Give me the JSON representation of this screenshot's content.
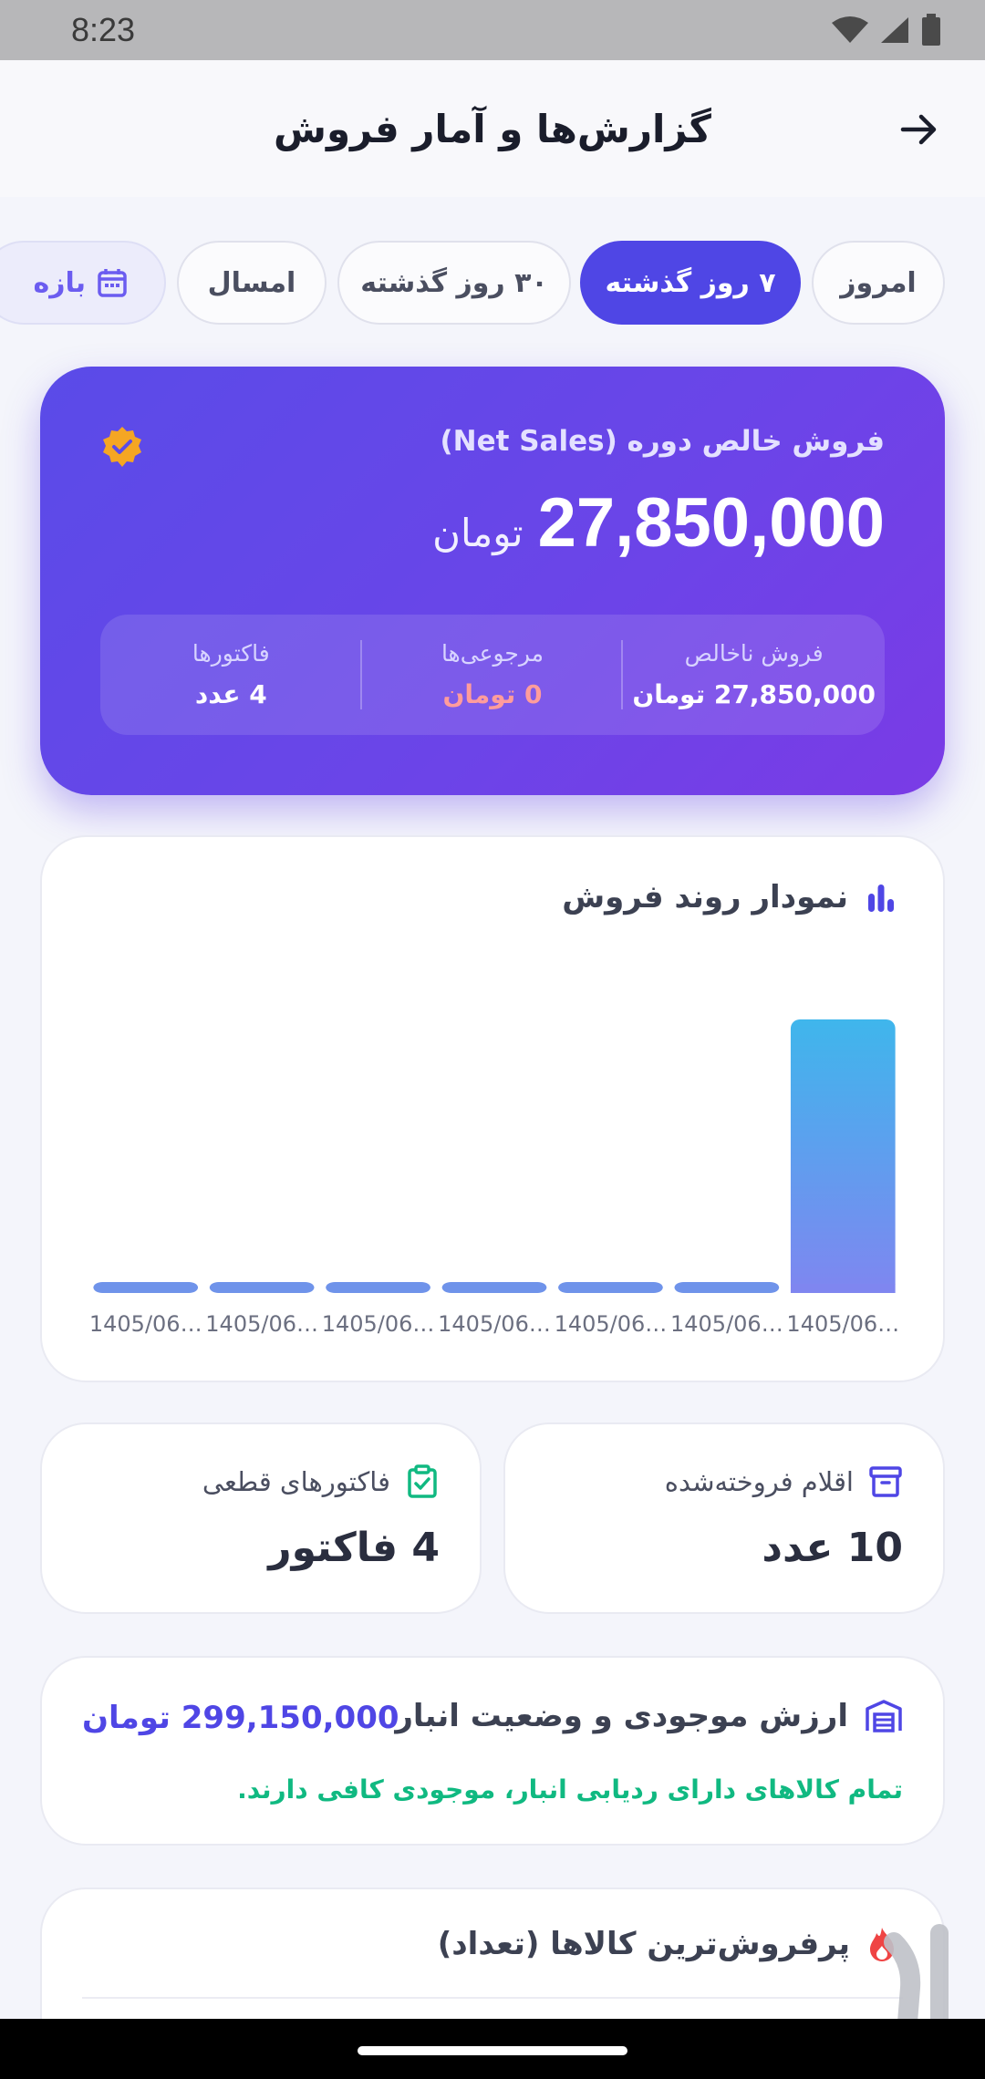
{
  "status_bar": {
    "time": "8:23"
  },
  "app_bar": {
    "title": "گزارش‌ها و آمار فروش"
  },
  "period_chips": [
    {
      "label": "امروز",
      "active": false
    },
    {
      "label": "۷ روز گذشته",
      "active": true
    },
    {
      "label": "۳۰ روز گذشته",
      "active": false
    },
    {
      "label": "امسال",
      "active": false
    },
    {
      "label": "بازه",
      "active": false
    }
  ],
  "summary": {
    "label": "فروش خالص دوره (Net Sales)",
    "amount": "27,850,000",
    "unit": "تومان",
    "gross_label": "فروش ناخالص",
    "gross_value": "27,850,000 تومان",
    "returns_label": "مرجوعی‌ها",
    "returns_value": "0 تومان",
    "invoices_label": "فاکتورها",
    "invoices_value": "4 عدد"
  },
  "chart": {
    "title": "نمودار روند فروش",
    "colors": {
      "bar_top": "#3fb6ec",
      "bar_bottom": "#7f86f0",
      "flat_bar": "#6f93ea"
    }
  },
  "chart_data": {
    "type": "bar",
    "title": "نمودار روند فروش",
    "categories": [
      "1405/06…",
      "1405/06…",
      "1405/06…",
      "1405/06…",
      "1405/06…",
      "1405/06…",
      "1405/06…"
    ],
    "values": [
      0,
      0,
      0,
      0,
      0,
      0,
      27850000
    ],
    "xlabel": "",
    "ylabel": "",
    "ylim": [
      0,
      27850000
    ],
    "grid": false
  },
  "stats": {
    "sold_items_label": "اقلام فروخته‌شده",
    "sold_items_value": "10 عدد",
    "final_invoices_label": "فاکتورهای قطعی",
    "final_invoices_value": "4 فاکتور"
  },
  "inventory": {
    "title": "ارزش موجودی و وضعیت انبار",
    "value": "299,150,000 تومان",
    "note": "تمام کالاهای دارای ردیابی انبار، موجودی کافی دارند."
  },
  "top_products": {
    "title": "پرفروش‌ترین کالاها (تعداد)"
  },
  "accent_colors": {
    "primary": "#4f46e5",
    "success": "#10b981",
    "warning": "#f5a623",
    "fire": "#ef4444"
  }
}
